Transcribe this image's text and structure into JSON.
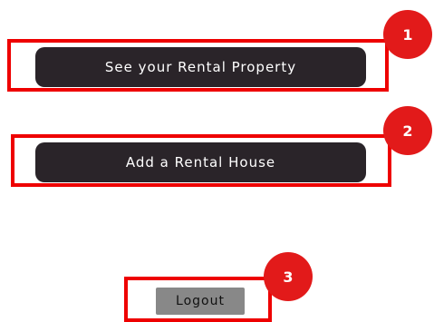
{
  "buttons": {
    "view_property": "See your Rental Property",
    "add_house": "Add a Rental House",
    "logout": "Logout"
  },
  "annotations": {
    "badge1": "1",
    "badge2": "2",
    "badge3": "3"
  },
  "colors": {
    "highlight": "#ee0000",
    "badge": "#e21a1a",
    "button_bg": "#2a2429",
    "logout_bg": "#888888"
  }
}
